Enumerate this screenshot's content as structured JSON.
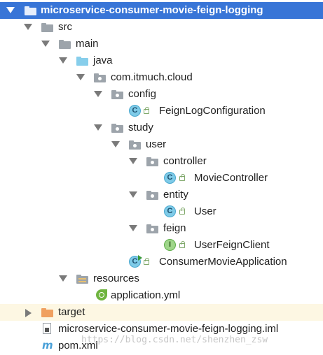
{
  "tree": {
    "project": "microservice-consumer-movie-feign-logging",
    "src": "src",
    "main": "main",
    "java": "java",
    "package": "com.itmuch.cloud",
    "config": "config",
    "feign_log_configuration": "FeignLogConfiguration",
    "study": "study",
    "user_pkg": "user",
    "controller": "controller",
    "movie_controller": "MovieController",
    "entity": "entity",
    "user_class": "User",
    "feign": "feign",
    "user_feign_client": "UserFeignClient",
    "consumer_movie_application": "ConsumerMovieApplication",
    "resources": "resources",
    "application_yml": "application.yml",
    "target": "target",
    "iml_file": "microservice-consumer-movie-feign-logging.iml",
    "pom": "pom.xml"
  },
  "icons": {
    "class_letter": "C",
    "interface_letter": "I",
    "maven_letter": "m"
  },
  "watermark": "https://blog.csdn.net/shenzhen_zsw",
  "colors": {
    "selection": "#3875d7",
    "target_row": "#fdf7e3",
    "folder_gray": "#9da4ab",
    "folder_source": "#87ceeb",
    "folder_excluded": "#f0a060",
    "class_icon": "#7fcbe8",
    "interface_icon": "#9fd68a"
  }
}
